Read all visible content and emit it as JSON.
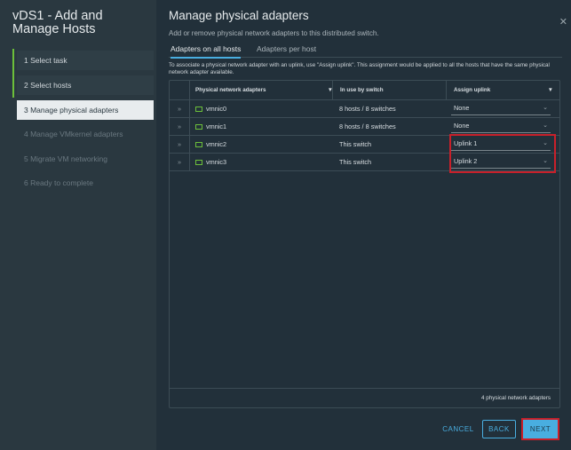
{
  "sidebar": {
    "title": "vDS1 - Add and Manage Hosts",
    "steps": [
      "1  Select task",
      "2  Select hosts",
      "3  Manage physical adapters",
      "4  Manage VMkernel adapters",
      "5  Migrate VM networking",
      "6  Ready to complete"
    ]
  },
  "main": {
    "title": "Manage physical adapters",
    "subtitle": "Add or remove physical network adapters to this distributed switch.",
    "tabs": [
      "Adapters on all hosts",
      "Adapters per host"
    ],
    "note": "To associate a physical network adapter with an uplink, use \"Assign uplink\". This assignment would be applied to all the hosts that have the same physical network adapter available.",
    "columns": [
      "Physical network adapters",
      "In use by switch",
      "Assign uplink"
    ],
    "rows": [
      {
        "name": "vmnic0",
        "use": "8 hosts / 8 switches",
        "uplink": "None"
      },
      {
        "name": "vmnic1",
        "use": "8 hosts / 8 switches",
        "uplink": "None"
      },
      {
        "name": "vmnic2",
        "use": "This switch",
        "uplink": "Uplink 1"
      },
      {
        "name": "vmnic3",
        "use": "This switch",
        "uplink": "Uplink 2"
      }
    ],
    "footer": "4 physical network adapters"
  },
  "buttons": {
    "cancel": "CANCEL",
    "back": "BACK",
    "next": "NEXT"
  },
  "colors": {
    "accent": "#49aee0",
    "highlight": "#c8202a",
    "done": "#6cbf3a"
  }
}
